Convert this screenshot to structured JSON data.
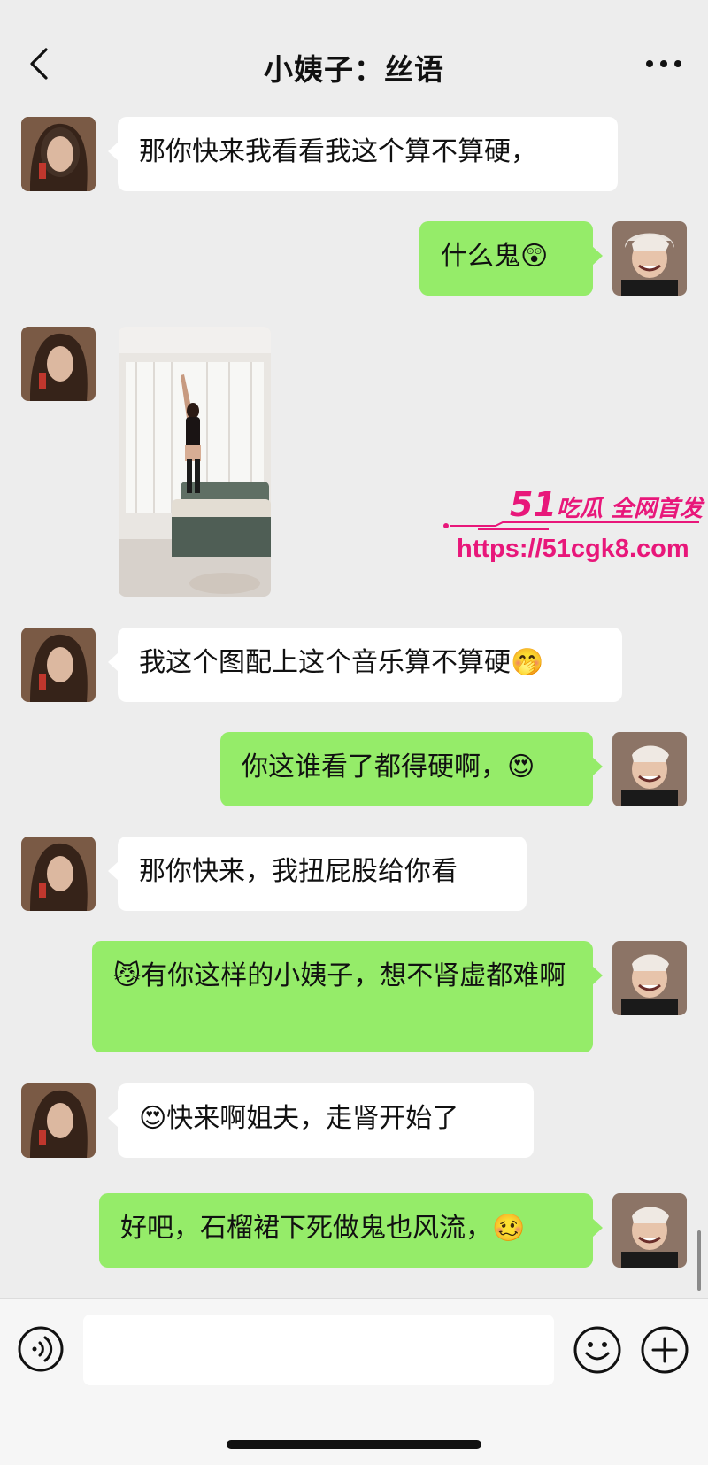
{
  "header": {
    "title": "小姨子：丝语"
  },
  "messages": [
    {
      "side": "left",
      "text": "那你快来我看看我这个算不算硬，"
    },
    {
      "side": "right",
      "text": "什么鬼",
      "emoji": "😲"
    },
    {
      "side": "left",
      "type": "image"
    },
    {
      "side": "left",
      "text": "我这个图配上这个音乐算不算硬",
      "emoji": "🤭"
    },
    {
      "side": "right",
      "text": "你这谁看了都得硬啊，",
      "emoji": "😍"
    },
    {
      "side": "left",
      "text": "那你快来，我扭屁股给你看"
    },
    {
      "side": "right",
      "emoji": "😼",
      "text": "有你这样的小姨子，想不肾虚都难啊"
    },
    {
      "side": "left",
      "emoji": "😍",
      "text": "快来啊姐夫，走肾开始了"
    },
    {
      "side": "right",
      "text": "好吧，石榴裙下死做鬼也风流，",
      "emoji": "🥴"
    }
  ],
  "watermark": {
    "brand_num": "51",
    "brand_text": "吃瓜 全网首发",
    "url": "https://51cgk8.com"
  },
  "input": {
    "value": ""
  },
  "colors": {
    "bubble_right": "#95ec69",
    "bubble_left": "#ffffff",
    "background": "#ededed",
    "watermark": "#e8177a"
  },
  "icons": [
    "back-icon",
    "more-icon",
    "voice-icon",
    "emoji-icon",
    "plus-icon"
  ]
}
